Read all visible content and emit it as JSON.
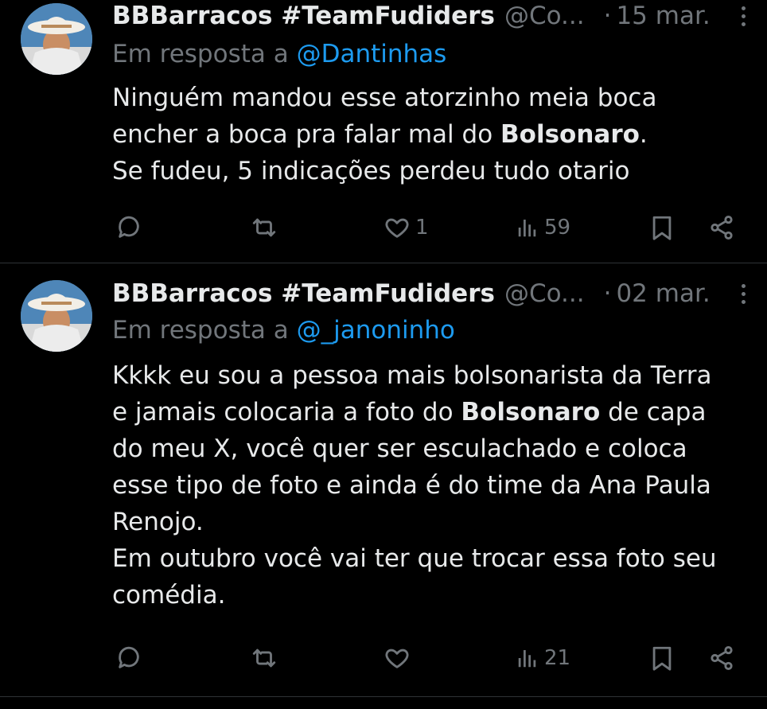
{
  "tweets": [
    {
      "display_name": "BBBarracos #TeamFudiders",
      "handle": "@Co...",
      "separator": "·",
      "date": "15 mar.",
      "reply_prefix": "Em resposta a",
      "reply_to": "@Dantinhas",
      "lines": [
        [
          "Ninguém mandou esse atorzinho meia boca"
        ],
        [
          "encher a boca pra falar mal do ",
          "Bolsonaro",
          "."
        ],
        [
          "Se fudeu, 5 indicações perdeu tudo otario"
        ]
      ],
      "likes": "1",
      "views": "59"
    },
    {
      "display_name": "BBBarracos #TeamFudiders",
      "handle": "@Co...",
      "separator": "·",
      "date": "02 mar.",
      "reply_prefix": "Em resposta a",
      "reply_to": "@_janoninho",
      "lines": [
        [
          "Kkkk eu sou a pessoa mais bolsonarista da Terra"
        ],
        [
          "e jamais colocaria a foto do ",
          "Bolsonaro",
          " de capa"
        ],
        [
          "do meu X, você quer ser esculachado e  coloca"
        ],
        [
          "esse tipo de foto e ainda é do time da Ana Paula"
        ],
        [
          "Renojo."
        ],
        [
          "Em outubro você vai ter que trocar essa foto seu"
        ],
        [
          "comédia."
        ]
      ],
      "likes": "",
      "views": "21"
    }
  ],
  "icons": {
    "reply": "reply-icon",
    "retweet": "retweet-icon",
    "like": "heart-icon",
    "views": "views-icon",
    "bookmark": "bookmark-icon",
    "share": "share-icon",
    "more": "more-icon"
  },
  "colors": {
    "background": "#000000",
    "text": "#e7e9ea",
    "muted": "#71767b",
    "link": "#1d9bf0"
  }
}
